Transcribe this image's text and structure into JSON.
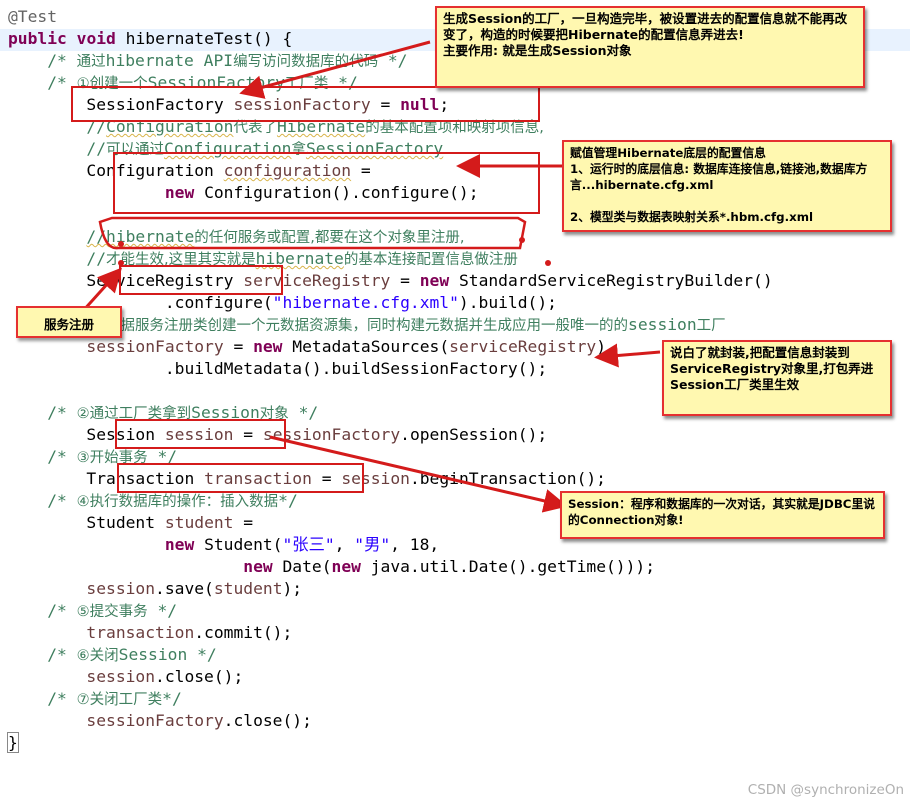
{
  "code": {
    "l1": "@Test",
    "l2_kw1": "public",
    "l2_kw2": "void",
    "l2_rest": " hibernateTest() {",
    "l3_a": "/* ",
    "l3_zh1": "通过",
    "l3_b": "hibernate API",
    "l3_zh2": "编写访问数据库的代码",
    "l3_c": " */",
    "l4_a": "/* ",
    "l4_zh1": "①创建一个",
    "l4_b": "SessionFactory",
    "l4_zh2": "工厂类",
    "l4_c": " */",
    "l5_type": "SessionFactory",
    "l5_var": "sessionFactory",
    "l5_eq": " = ",
    "l5_kw": "null",
    "l5_end": ";",
    "l6_a": "//",
    "l6_b": "Configuration",
    "l6_zh1": "代表了",
    "l6_c": "Hibernate",
    "l6_zh2": "的基本配置项和映射项信息,",
    "l7_a": "//",
    "l7_zh1": "可以通过",
    "l7_b": "Configuration",
    "l7_zh2": "拿",
    "l7_c": "SessionFactory",
    "l8_type": "Configuration",
    "l8_var": "configuration",
    "l8_eq": " =",
    "l9_kw": "new",
    "l9_rest": " Configuration().configure();",
    "l11_a": "//hibernate",
    "l11_zh": "的任何服务或配置,都要在这个对象里注册,",
    "l12_a": "//",
    "l12_zh1": "才能生效,这里其实就是",
    "l12_b": "hibernate",
    "l12_zh2": "的基本连接配置信息做注册",
    "l13_type": "ServiceRegistry",
    "l13_var": "serviceRegistry",
    "l13_eq": " = ",
    "l13_kw": "new",
    "l13_rest": " StandardServiceRegistryBuilder()",
    "l14_a": ".configure(",
    "l14_str": "\"hibernate.cfg.xml\"",
    "l14_b": ").build();",
    "l15_a": "//",
    "l15_zh": "根据服务注册类创建一个元数据资源集，同时构建元数据并生成应用一般唯一的的",
    "l15_b": "session",
    "l15_zh2": "工厂",
    "l16_var": "sessionFactory",
    "l16_eq": " = ",
    "l16_kw": "new",
    "l16_rest": " MetadataSources(",
    "l16_var2": "serviceRegistry",
    "l16_end": ")",
    "l17": ".buildMetadata().buildSessionFactory();",
    "l19_a": "/* ",
    "l19_zh1": "②通过工厂类拿到",
    "l19_b": "Session",
    "l19_zh2": "对象",
    "l19_c": " */",
    "l20_type": "Session",
    "l20_var": "session",
    "l20_eq": " = ",
    "l20_var2": "sessionFactory",
    "l20_rest": ".openSession();",
    "l21_a": "/* ",
    "l21_zh": "③开始事务",
    "l21_c": " */",
    "l22_type": "Transaction",
    "l22_var": "transaction",
    "l22_eq": " = ",
    "l22_var2": "session",
    "l22_rest": ".beginTransaction();",
    "l23_a": "/* ",
    "l23_zh": "④执行数据库的操作：插入数据",
    "l23_c": "*/",
    "l24_type": "Student",
    "l24_var": "student",
    "l24_eq": " =",
    "l25_kw": "new",
    "l25_a": " Student(",
    "l25_s1": "\"张三\"",
    "l25_b": ", ",
    "l25_s2": "\"男\"",
    "l25_c": ", 18,",
    "l26_kw1": "new",
    "l26_a": " Date(",
    "l26_kw2": "new",
    "l26_b": " java.util.Date().getTime()));",
    "l27_var": "session",
    "l27_rest": ".save(",
    "l27_var2": "student",
    "l27_end": ");",
    "l28_a": "/* ",
    "l28_zh": "⑤提交事务",
    "l28_c": " */",
    "l29_var": "transaction",
    "l29_rest": ".commit();",
    "l30_a": "/* ",
    "l30_zh1": "⑥关闭",
    "l30_b": "Session",
    "l30_c": " */",
    "l31_var": "session",
    "l31_rest": ".close();",
    "l32_a": "/* ",
    "l32_zh": "⑦关闭工厂类",
    "l32_c": "*/",
    "l33_var": "sessionFactory",
    "l33_rest": ".close();",
    "l34": "}"
  },
  "notes": {
    "session_factory": "生成Session的工厂，一旦构造完毕，被设置进去的配置信息就不能再改变了，构造的时候要把Hibernate的配置信息弄进去!\n主要作用: 就是生成Session对象",
    "configuration": "赋值管理Hibernate底层的配置信息\n1、运行时的底层信息: 数据库连接信息,链接池,数据库方言...hibernate.cfg.xml\n\n2、模型类与数据表映射关系*.hbm.cfg.xml",
    "service_registration": "服务注册",
    "service_registry": "说白了就封装,把配置信息封装到ServiceRegistry对象里,打包弄进Session工厂类里生效",
    "session": "Session：程序和数据库的一次对话，其实就是JDBC里说的Connection对象!"
  },
  "watermark": "CSDN @synchronizeOn",
  "colors": {
    "keyword": "#7f0055",
    "comment": "#3f7f5f",
    "variable": "#6a3e3e",
    "string": "#2a00ff",
    "annotation": "#646464",
    "highlight_line": "#e8f2fe",
    "annotation_box": "#d41b1b",
    "note_background": "#fff8b0"
  }
}
